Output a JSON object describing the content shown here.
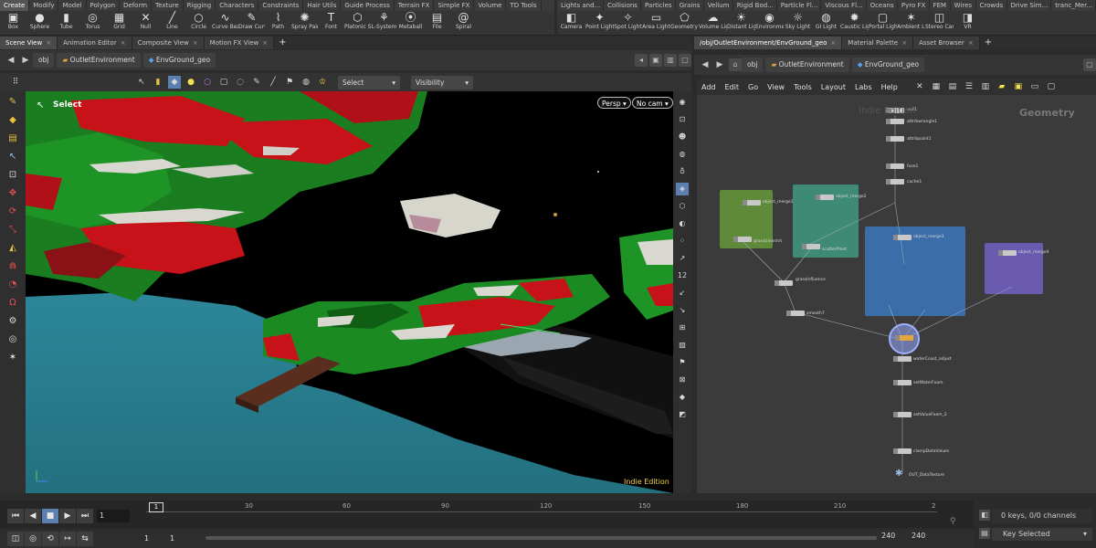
{
  "shelf_tabs_left": [
    "Create",
    "Modify",
    "Model",
    "Polygon",
    "Deform",
    "Texture",
    "Rigging",
    "Characters",
    "Constraints",
    "Hair Utils",
    "Guide Process",
    "Terrain FX",
    "Simple FX",
    "Volume",
    "TD Tools"
  ],
  "shelf_tabs_right": [
    "Lights and...",
    "Collisions",
    "Particles",
    "Grains",
    "Vellum",
    "Rigid Bod...",
    "Particle Fl...",
    "Viscous Fl...",
    "Oceans",
    "Pyro FX",
    "FEM",
    "Wires",
    "Crowds",
    "Drive Sim...",
    "tranc_Mer..."
  ],
  "shelf_tools_left": [
    {
      "label": "Box",
      "icon": "▣"
    },
    {
      "label": "Sphere",
      "icon": "●"
    },
    {
      "label": "Tube",
      "icon": "▮"
    },
    {
      "label": "Torus",
      "icon": "◎"
    },
    {
      "label": "Grid",
      "icon": "▦"
    },
    {
      "label": "Null",
      "icon": "✕"
    },
    {
      "label": "Line",
      "icon": "╱"
    },
    {
      "label": "Circle",
      "icon": "○"
    },
    {
      "label": "Curve Bezier",
      "icon": "∿"
    },
    {
      "label": "Draw Curve",
      "icon": "✎"
    },
    {
      "label": "Path",
      "icon": "⌇"
    },
    {
      "label": "Spray Paint",
      "icon": "✺"
    },
    {
      "label": "Font",
      "icon": "T"
    },
    {
      "label": "Platonic Solids",
      "icon": "⬡"
    },
    {
      "label": "L-System",
      "icon": "⚘"
    },
    {
      "label": "Metaball",
      "icon": "⦿"
    },
    {
      "label": "File",
      "icon": "▤"
    },
    {
      "label": "Spiral",
      "icon": "@"
    }
  ],
  "shelf_tools_right": [
    {
      "label": "Camera",
      "icon": "◧"
    },
    {
      "label": "Point Light",
      "icon": "✦"
    },
    {
      "label": "Spot Light",
      "icon": "✧"
    },
    {
      "label": "Area Light",
      "icon": "▭"
    },
    {
      "label": "Geometry Light",
      "icon": "⬠"
    },
    {
      "label": "Volume Light",
      "icon": "☁"
    },
    {
      "label": "Distant Light",
      "icon": "☀"
    },
    {
      "label": "Environment Light",
      "icon": "◉"
    },
    {
      "label": "Sky Light",
      "icon": "☼"
    },
    {
      "label": "GI Light",
      "icon": "◍"
    },
    {
      "label": "Caustic Light",
      "icon": "✹"
    },
    {
      "label": "Portal Light",
      "icon": "▢"
    },
    {
      "label": "Ambient Light",
      "icon": "✶"
    },
    {
      "label": "Stereo Camera",
      "icon": "◫"
    },
    {
      "label": "VR",
      "icon": "◨"
    }
  ],
  "left_pane_tabs": [
    "Scene View",
    "Animation Editor",
    "Composite View",
    "Motion FX View"
  ],
  "right_pane_tabs": [
    "/obj/OutletEnvironment/EnvGround_geo",
    "Material Palette",
    "Asset Browser"
  ],
  "path_left": {
    "obj": "obj",
    "network": "OutletEnvironment",
    "geo": "EnvGround_geo"
  },
  "path_right": {
    "obj": "obj",
    "network": "OutletEnvironment",
    "geo": "EnvGround_geo"
  },
  "viewport": {
    "select_label": "Select",
    "select_dropdown": "Select",
    "visibility_dropdown": "Visibility",
    "persp": "Persp",
    "cam": "No cam",
    "edition": "Indie Edition"
  },
  "net_menu": [
    "Add",
    "Edit",
    "Go",
    "View",
    "Tools",
    "Layout",
    "Labs",
    "Help"
  ],
  "net_context": "Geometry",
  "net_watermark": "Indie Edition",
  "nodes": [
    {
      "label": "null1"
    },
    {
      "label": "attribwrangle1"
    },
    {
      "label": "attribpaint1"
    },
    {
      "label": "fuse1"
    },
    {
      "label": "cache1"
    },
    {
      "label": "object_merge1"
    },
    {
      "label": "object_merge2"
    },
    {
      "label": "object_merge3"
    },
    {
      "label": "object_merge4"
    },
    {
      "label": "grassUnionInt"
    },
    {
      "label": "scatterPlant"
    },
    {
      "label": "grassInfluence"
    },
    {
      "label": "smooth7"
    },
    {
      "label": "waterCoast_adjust"
    },
    {
      "label": "setWaterFoam"
    },
    {
      "label": "setValueFoam_2"
    },
    {
      "label": "clampDataValues"
    },
    {
      "label": "OUT_DataTexture"
    }
  ],
  "timeline": {
    "ticks": [
      "1",
      "30",
      "60",
      "90",
      "120",
      "150",
      "180",
      "210",
      "2"
    ],
    "current_frame": "1",
    "start": "1",
    "range_start": "1",
    "range_end": "240",
    "end": "240",
    "keys_info": "0 keys, 0/0 channels",
    "key_selected": "Key Selected"
  }
}
